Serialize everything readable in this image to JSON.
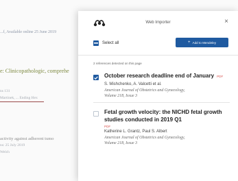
{
  "background": {
    "line1": "...f, Available online 25 June 2019",
    "line2": "e: Clinicopathologic, comprehe",
    "line3": "ns 131",
    "line4": "Martinek, ... Ending Hex",
    "line5": "activity against adherent tumo",
    "line6": "ns: 25 July 2019",
    "line7": "Welch"
  },
  "importer": {
    "title": "Web Importer",
    "close_symbol": "×",
    "select_all_label": "Select all",
    "add_button_label": "Add to Mendeley",
    "reference_count_text": "2 references detected on this page",
    "references": [
      {
        "title": "October research deadline end of January",
        "tag": "PDF",
        "checked": true,
        "authors": "S. Mishchenko, A. Valcetti et al.",
        "journal_line1": "American Journal of Obstetrics and Gynecology,",
        "journal_line2": "Volume 218, Issue 3"
      },
      {
        "title": "Fetal growth velocity: the NICHD fetal growth studies conducted in 2019 Q1",
        "tag": "PDF",
        "checked": false,
        "authors": "Katherine L. Grantz, Paul S. Albert",
        "journal_line1": "American Journal of Obstetrics and Gynecology,",
        "journal_line2": "Volume 218, Issue 3"
      }
    ]
  },
  "colors": {
    "accent": "#1f5aa0",
    "pdf_tag": "#d9534f"
  },
  "icons": {
    "logo": "mendeley-logo-icon",
    "close": "close-icon",
    "add": "plus-icon"
  }
}
